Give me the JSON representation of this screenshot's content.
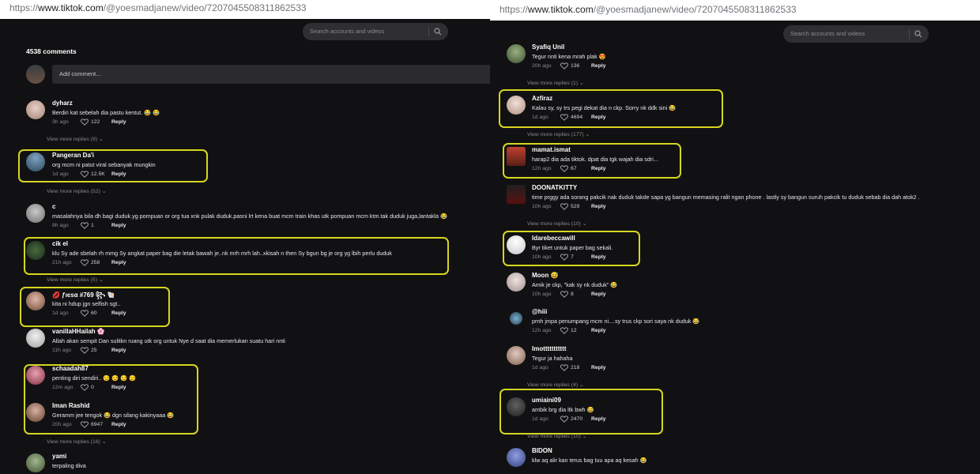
{
  "left": {
    "url": {
      "prefix": "https://",
      "host": "www.tiktok.com",
      "path": "/@yoesmadjanew/video/7207045508311862533"
    },
    "search_placeholder": "Search accounts and videos",
    "comment_count": "4538 comments",
    "add_comment_placeholder": "Add comment...",
    "comments": [
      {
        "name": "dyharz",
        "text": "Berdiri kat sebelah dia pastu kentut. 😂 😂",
        "age": "3h ago",
        "likes": "122",
        "reply": "Reply",
        "view_more": "View more replies (9)"
      },
      {
        "name": "Pangeran Da'i",
        "text": "org mcm ni patut viral sebanyak mungkin",
        "age": "1d ago",
        "likes": "12.5K",
        "reply": "Reply",
        "view_more": "View more replies (52)"
      },
      {
        "name": "c",
        "text": "masalahnya bila dh bagi duduk.yg pompuan or org tua xnk pulak duduk.pasni lrt kena buat mcm train khas utk pompuan mcm ktm.tak duduk juga,lantakla 😂",
        "age": "8h ago",
        "likes": "1",
        "reply": "Reply",
        "view_more": ""
      },
      {
        "name": "cik el",
        "text": "klu Sy ade sbelah rh mmg Sy angkat paper bag die letak bawah je..nk mrh mrh lah..xkisah n then Sy bgun bg je org yg lbih perlu duduk",
        "age": "21h ago",
        "likes": "258",
        "reply": "Reply",
        "view_more": "View more replies (5)"
      },
      {
        "name": "💋 ƒιєѕα #769 ꧂ 🐚",
        "text": "kita ni hdup jgn selfish sgt..",
        "age": "1d ago",
        "likes": "60",
        "reply": "Reply",
        "view_more": ""
      },
      {
        "name": "vanillaHHailah 🌸",
        "text": "Allah akan sempit Dan sulitkn ruang utk org untuk Nye d saat dia memerlukan suatu hari nnti",
        "age": "11h ago",
        "likes": "25",
        "reply": "Reply",
        "view_more": ""
      },
      {
        "name": "schaadah87",
        "text": "penting diri sendiri.. 😒 😒 😒 😒",
        "age": "12m ago",
        "likes": "0",
        "reply": "Reply",
        "view_more": ""
      },
      {
        "name": "Iman Rashid",
        "text": "Geramm jee tengok 😂 dgn silang kakinyaaa 😂",
        "age": "20h ago",
        "likes": "6947",
        "reply": "Reply",
        "view_more": "View more replies (16)"
      },
      {
        "name": "yami",
        "text": "terpaling diva",
        "age": "",
        "likes": "",
        "reply": "",
        "view_more": ""
      }
    ]
  },
  "right": {
    "url": {
      "prefix": "https://",
      "host": "www.tiktok.com",
      "path": "/@yoesmadjanew/video/7207045508311862533"
    },
    "search_placeholder": "Search accounts and videos",
    "comments": [
      {
        "name": "Syafiq Unil",
        "text": "Tegur nnti kena mrah plak 😍",
        "age": "20h ago",
        "likes": "136",
        "reply": "Reply",
        "view_more": "View more replies (1)"
      },
      {
        "name": "Azfiraz",
        "text": "Kalau sy, sy trs pegi dekat dia n ckp. Sorry nk ddk sini 😂",
        "age": "1d ago",
        "likes": "4694",
        "reply": "Reply",
        "view_more": "View more replies (177)"
      },
      {
        "name": "mamat.ismat",
        "text": "harap2 dia ada tiktok. dpat dia tgk wajah dia sdri...",
        "age": "12h ago",
        "likes": "67",
        "reply": "Reply",
        "view_more": ""
      },
      {
        "name": "DOONATKITTY",
        "text": "time prggy ada sorang pakcik nak duduk takde sapa yg bangun memasing ralit ngan phone . lastly sy bangun suruh pakcik tu duduk sebab dia dah atok2 .",
        "age": "10h ago",
        "likes": "529",
        "reply": "Reply",
        "view_more": "View more replies (10)"
      },
      {
        "name": "Idarebeccawill",
        "text": "Byr tiket untuk paper bag sekali.",
        "age": "10h ago",
        "likes": "7",
        "reply": "Reply",
        "view_more": ""
      },
      {
        "name": "Moon 😅",
        "text": "Amik je ckp, \"kak sy nk duduk\" 😂",
        "age": "10h ago",
        "likes": "8",
        "reply": "Reply",
        "view_more": ""
      },
      {
        "name": "@hiii",
        "text": "prnh jmpa penumpang mcm ni....sy trus ckp sori saya nk duduk 😂",
        "age": "12h ago",
        "likes": "12",
        "reply": "Reply",
        "view_more": ""
      },
      {
        "name": "Imottttttttttt",
        "text": "Tegur ja hahaha",
        "age": "1d ago",
        "likes": "218",
        "reply": "Reply",
        "view_more": "View more replies (4)"
      },
      {
        "name": "umiaini09",
        "text": "ambik brg dia ltk bwh 😂",
        "age": "1d ago",
        "likes": "2470",
        "reply": "Reply",
        "view_more": "View more replies (10)"
      },
      {
        "name": "BIDON",
        "text": "klw aq alir kan terus bag tuu apa aq kesah 😂",
        "age": "",
        "likes": "",
        "reply": "",
        "view_more": ""
      }
    ]
  },
  "colors": {
    "highlight": "#d6d620",
    "background": "#111113"
  }
}
